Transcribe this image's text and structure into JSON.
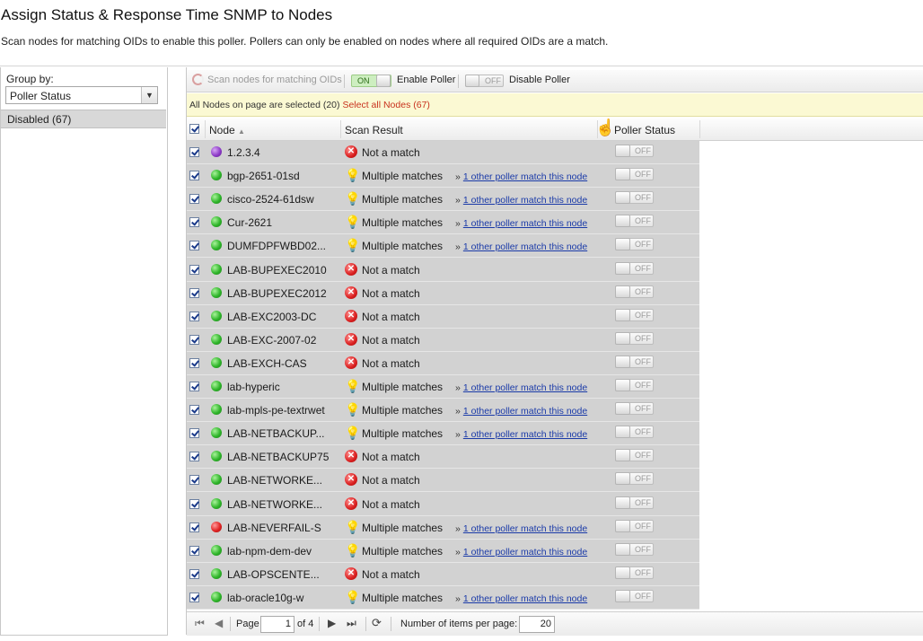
{
  "page": {
    "title": "Assign Status & Response Time SNMP to Nodes",
    "description": "Scan nodes for matching OIDs to enable this poller. Pollers can only be enabled on nodes where all required OIDs are a match."
  },
  "left_panel": {
    "group_by_label": "Group by:",
    "group_by_value": "Poller Status",
    "group_item": "Disabled (67)"
  },
  "toolbar": {
    "scan_label": "Scan nodes for matching OIDs",
    "on_label": "ON",
    "enable_label": "Enable Poller",
    "off_label": "OFF",
    "disable_label": "Disable Poller"
  },
  "selection": {
    "text": "All Nodes on page are selected (20)",
    "select_all": "Select all Nodes (67)"
  },
  "grid": {
    "columns": [
      "Node",
      "Scan Result",
      "Poller Status"
    ],
    "sort_indicator": "▲",
    "off_label": "OFF",
    "other_link": "1 other poller match this node",
    "link_arrow": "»",
    "rows": [
      {
        "status": "purple",
        "node": "1.2.3.4",
        "result": "Not a match",
        "match": false
      },
      {
        "status": "green",
        "node": "bgp-2651-01sd",
        "result": "Multiple matches",
        "match": true
      },
      {
        "status": "green",
        "node": "cisco-2524-61dsw",
        "result": "Multiple matches",
        "match": true
      },
      {
        "status": "green",
        "node": "Cur-2621",
        "result": "Multiple matches",
        "match": true
      },
      {
        "status": "green",
        "node": "DUMFDPFWBD02...",
        "result": "Multiple matches",
        "match": true
      },
      {
        "status": "green",
        "node": "LAB-BUPEXEC2010",
        "result": "Not a match",
        "match": false
      },
      {
        "status": "green",
        "node": "LAB-BUPEXEC2012",
        "result": "Not a match",
        "match": false
      },
      {
        "status": "green",
        "node": "LAB-EXC2003-DC",
        "result": "Not a match",
        "match": false
      },
      {
        "status": "green",
        "node": "LAB-EXC-2007-02",
        "result": "Not a match",
        "match": false
      },
      {
        "status": "green",
        "node": "LAB-EXCH-CAS",
        "result": "Not a match",
        "match": false
      },
      {
        "status": "green",
        "node": "lab-hyperic",
        "result": "Multiple matches",
        "match": true
      },
      {
        "status": "green",
        "node": "lab-mpls-pe-textrwet",
        "result": "Multiple matches",
        "match": true
      },
      {
        "status": "green",
        "node": "LAB-NETBACKUP...",
        "result": "Multiple matches",
        "match": true
      },
      {
        "status": "green",
        "node": "LAB-NETBACKUP75",
        "result": "Not a match",
        "match": false
      },
      {
        "status": "green",
        "node": "LAB-NETWORKE...",
        "result": "Not a match",
        "match": false
      },
      {
        "status": "green",
        "node": "LAB-NETWORKE...",
        "result": "Not a match",
        "match": false
      },
      {
        "status": "red",
        "node": "LAB-NEVERFAIL-S",
        "result": "Multiple matches",
        "match": true
      },
      {
        "status": "green",
        "node": "lab-npm-dem-dev",
        "result": "Multiple matches",
        "match": true
      },
      {
        "status": "green",
        "node": "LAB-OPSCENTE...",
        "result": "Not a match",
        "match": false
      },
      {
        "status": "green",
        "node": "lab-oracle10g-w",
        "result": "Multiple matches",
        "match": true
      }
    ]
  },
  "pager": {
    "page_label": "Page",
    "page_value": "1",
    "of_label": "of 4",
    "items_label": "Number of items per page:",
    "items_value": "20"
  },
  "colors": {
    "selection_bg": "#fbf9d3",
    "select_all_link": "#c8321e",
    "row_bg": "#d2d2d2",
    "link": "#1a3aa8"
  }
}
